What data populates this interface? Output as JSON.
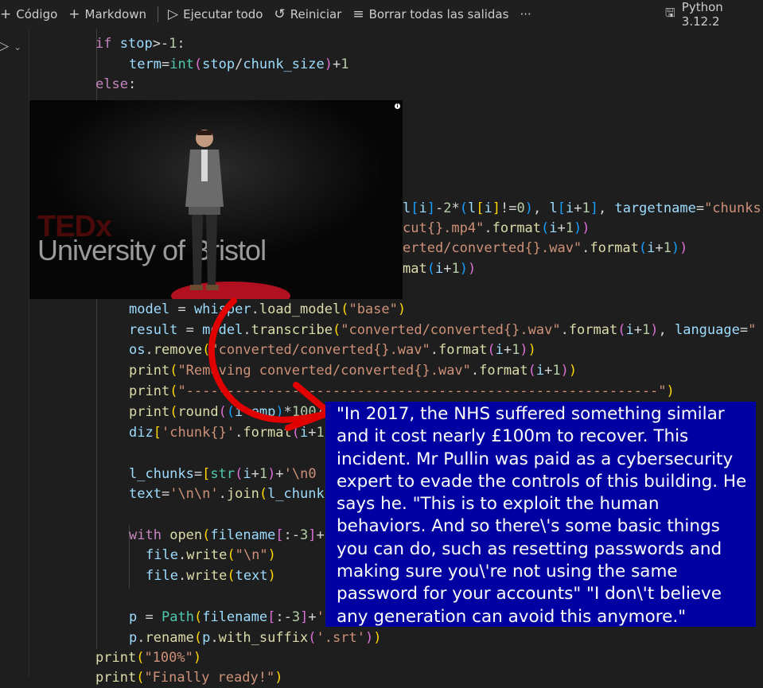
{
  "toolbar": {
    "code_label": "Código",
    "markdown_label": "Markdown",
    "run_all_label": "Ejecutar todo",
    "restart_label": "Reiniciar",
    "clear_outputs_label": "Borrar todas las salidas",
    "more_label": "···",
    "kernel_label": "Python 3.12.2"
  },
  "code": {
    "l1": "if stop>-1:",
    "l2": "    term=int(stop/chunk_size)+1",
    "l3": "else:",
    "l4": "l[i]-2*(l[i]!=0), l[i+1], targetname=\"chunks",
    "l5": "cut{}.mp4\".format(i+1))",
    "l6": "erted/converted{}.wav\".format(i+1))",
    "l7": "mat(i+1))",
    "l8": "model = whisper.load_model(\"base\")",
    "l9": "result = model.transcribe(\"converted/converted{}.wav\".format(i+1), language=",
    "l10": "os.remove(\"converted/converted{}.wav\".format(i+1))",
    "l11": "print(\"Removing converted/converted{}.wav\".format(i+1))",
    "l12": "print(\"--------------------------------------------------------\")",
    "l13": "print(round((i-emp)*100/",
    "l14": "diz['chunk{}'.format(i+1",
    "l15": "l_chunks=[str(i+1)+'\\n0",
    "l16": "text='\\n\\n'.join(l_chunk",
    "l17": "with open(filename[:-3]+",
    "l18": "file.write(\"\\n\")",
    "l19": "file.write(text)",
    "l20": "p = Path(filename[:-3]+'",
    "l21": "p.rename(p.with_suffix('.srt'))",
    "l22": "print(\"100%\")",
    "l23": "print(\"Finally ready!\")"
  },
  "video": {
    "logo_tedx": "TEDx",
    "logo_university": "University of Bristol"
  },
  "subtitle": {
    "text": "\"In 2017, the NHS suffered something similar and it cost nearly £100m to recover. This incident. Mr Pullin was paid as a cybersecurity expert to evade the controls of this building. He says he. \"This is to exploit the human behaviors. And so there\\'s some basic things you can do, such as resetting passwords and making sure you\\'re not using the same password for your accounts\" \"I don\\'t believe any generation can avoid this anymore.\""
  },
  "colors": {
    "editor_bg": "#1e1e1e",
    "subtitle_bg": "#0000a2",
    "arrow": "#e00000"
  }
}
